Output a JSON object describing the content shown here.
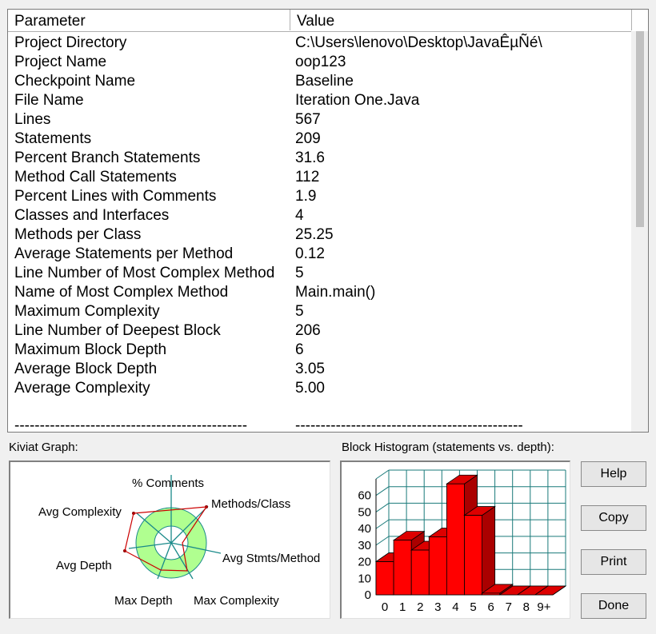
{
  "table": {
    "headers": {
      "parameter": "Parameter",
      "value": "Value"
    },
    "rows": [
      {
        "parameter": "Project Directory",
        "value": "C:\\Users\\lenovo\\Desktop\\JavaÊµÑé\\"
      },
      {
        "parameter": "Project Name",
        "value": "oop123"
      },
      {
        "parameter": "Checkpoint Name",
        "value": "Baseline"
      },
      {
        "parameter": "File Name",
        "value": "Iteration One.Java"
      },
      {
        "parameter": "Lines",
        "value": "567"
      },
      {
        "parameter": "Statements",
        "value": "209"
      },
      {
        "parameter": "Percent Branch Statements",
        "value": "31.6"
      },
      {
        "parameter": "Method Call Statements",
        "value": "112"
      },
      {
        "parameter": "Percent Lines with Comments",
        "value": "1.9"
      },
      {
        "parameter": "Classes and Interfaces",
        "value": "4"
      },
      {
        "parameter": "Methods per Class",
        "value": "25.25"
      },
      {
        "parameter": "Average Statements per Method",
        "value": "0.12"
      },
      {
        "parameter": "Line Number of Most Complex Method",
        "value": "5"
      },
      {
        "parameter": "Name of Most Complex Method",
        "value": "Main.main()"
      },
      {
        "parameter": "Maximum Complexity",
        "value": "5"
      },
      {
        "parameter": "Line Number of Deepest Block",
        "value": "206"
      },
      {
        "parameter": "Maximum Block Depth",
        "value": "6"
      },
      {
        "parameter": "Average Block Depth",
        "value": "3.05"
      },
      {
        "parameter": "Average Complexity",
        "value": "5.00"
      }
    ],
    "separator_param": "----------------------------------------------",
    "separator_value": "---------------------------------------------"
  },
  "kiviat": {
    "label": "Kiviat Graph:",
    "axes": [
      "% Comments",
      "Methods/Class",
      "Avg Stmts/Method",
      "Max Complexity",
      "Max Depth",
      "Avg Depth",
      "Avg Complexity"
    ],
    "colors": {
      "ring_fill": "#b0ff90",
      "ring_stroke": "#1a8a8a",
      "axis": "#1a8a8a",
      "polygon": "#cc0000",
      "arrow": "#8b0000"
    }
  },
  "histogram": {
    "label": "Block Histogram (statements vs. depth):",
    "colors": {
      "bar_face": "#ff0000",
      "bar_top": "#dd0000",
      "bar_side": "#aa0000",
      "grid": "#1a7a7a"
    }
  },
  "chart_data": {
    "type": "bar",
    "title": "Block Histogram (statements vs. depth):",
    "categories": [
      "0",
      "1",
      "2",
      "3",
      "4",
      "5",
      "6",
      "7",
      "8",
      "9+"
    ],
    "values": [
      20,
      33,
      27,
      35,
      67,
      48,
      1,
      0,
      0,
      0
    ],
    "ylim": [
      0,
      60
    ],
    "yticks": [
      "0",
      "10",
      "20",
      "30",
      "40",
      "50",
      "60"
    ],
    "grid": true
  },
  "buttons": {
    "help": "Help",
    "copy": "Copy",
    "print": "Print",
    "done": "Done"
  }
}
